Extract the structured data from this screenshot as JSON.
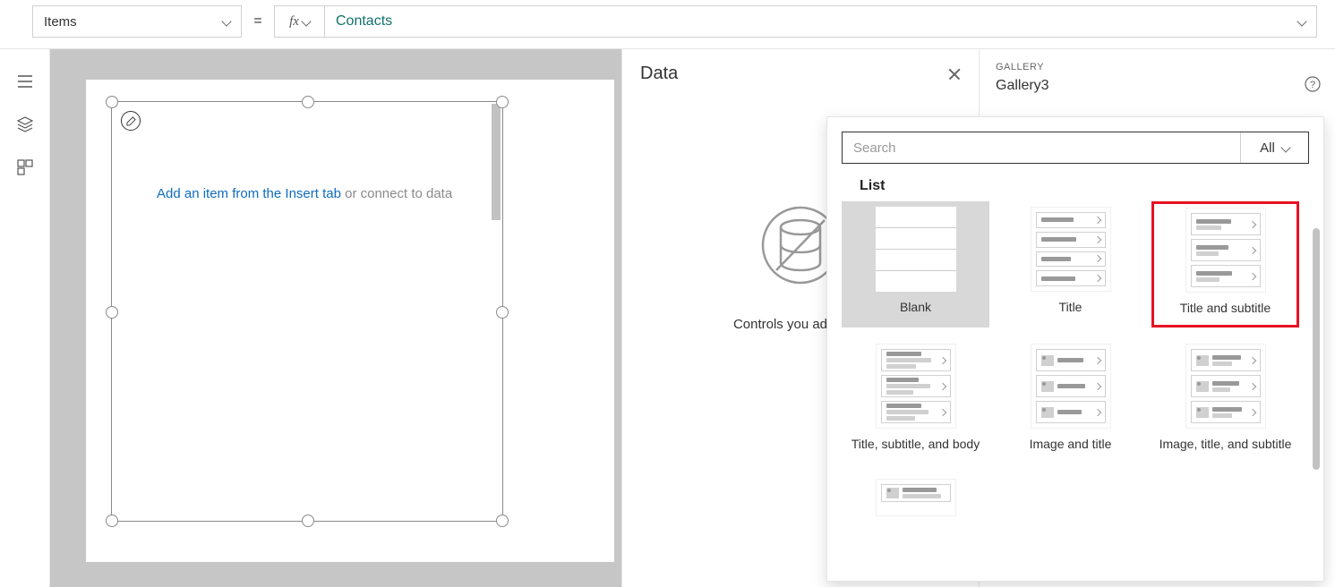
{
  "formula": {
    "property": "Items",
    "equals": "=",
    "fx": "fx",
    "value": "Contacts"
  },
  "dataPanel": {
    "title": "Data",
    "emptyText": "Controls you add will s"
  },
  "gallery": {
    "label": "GALLERY",
    "name": "Gallery3"
  },
  "canvas": {
    "insertBlue": "Add an item from the Insert tab ",
    "insertGray": "or connect to data"
  },
  "picker": {
    "searchPlaceholder": "Search",
    "filter": "All",
    "category": "List",
    "options": [
      {
        "label": "Blank"
      },
      {
        "label": "Title"
      },
      {
        "label": "Title and subtitle"
      },
      {
        "label": "Title, subtitle, and body"
      },
      {
        "label": "Image and title"
      },
      {
        "label": "Image, title, and subtitle"
      }
    ]
  }
}
